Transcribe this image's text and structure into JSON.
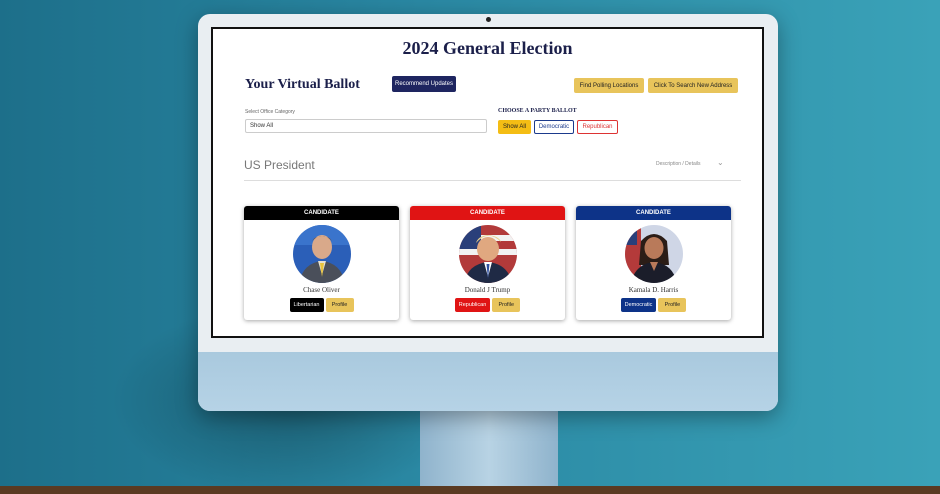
{
  "page": {
    "title": "2024 General Election",
    "ballot_title": "Your Virtual Ballot",
    "buttons": {
      "recommend": "Recommend Updates",
      "polling": "Find Polling Locations",
      "address": "Click To Search New Address"
    },
    "category": {
      "label": "Select Office Category",
      "value": "Show All"
    },
    "party": {
      "label": "CHOOSE A PARTY BALLOT",
      "options": [
        "Show All",
        "Democratic",
        "Republican"
      ],
      "selected": "Show All"
    },
    "section": {
      "title": "US President",
      "details_label": "Description / Details"
    }
  },
  "candidates": [
    {
      "header": "CANDIDATE",
      "name": "Chase Oliver",
      "party": "Libertarian",
      "profile_label": "Profile",
      "color": "#000000"
    },
    {
      "header": "CANDIDATE",
      "name": "Donald J Trump",
      "party": "Republican",
      "profile_label": "Profile",
      "color": "#e01414"
    },
    {
      "header": "CANDIDATE",
      "name": "Kamala D. Harris",
      "party": "Democratic",
      "profile_label": "Profile",
      "color": "#0d3388"
    }
  ],
  "colors": {
    "navy": "#1b1f4a",
    "gold": "#e8c45b",
    "showall": "#f4bd14"
  }
}
